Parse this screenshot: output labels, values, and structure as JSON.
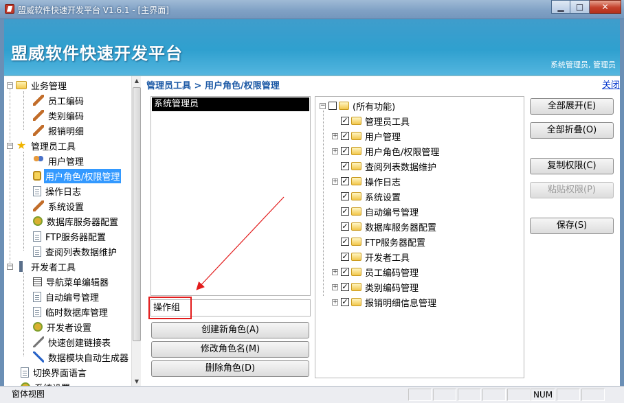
{
  "window": {
    "title": "盟威软件快速开发平台 V1.6.1 - [主界面]",
    "minimize_glyph": "▁",
    "maximize_glyph": "□",
    "close_glyph": "✕"
  },
  "banner": {
    "brand": "盟威软件快速开发平台",
    "user_info": "系统管理员, 管理员"
  },
  "nav": {
    "groups": [
      {
        "label": "业务管理",
        "expander": "−",
        "children": [
          "员工编码",
          "类别编码",
          "报销明细"
        ]
      },
      {
        "label": "管理员工具",
        "expander": "−",
        "children": [
          "用户管理",
          "用户角色/权限管理",
          "操作日志",
          "系统设置",
          "数据库服务器配置",
          "FTP服务器配置",
          "查阅列表数据维护"
        ]
      },
      {
        "label": "开发者工具",
        "expander": "−",
        "children": [
          "导航菜单编辑器",
          "自动编号管理",
          "临时数据库管理",
          "开发者设置",
          "快速创建链接表",
          "数据模块自动生成器"
        ]
      }
    ],
    "bottom_items": [
      "切换界面语言",
      "系统设置"
    ],
    "selected": "用户角色/权限管理",
    "scroll_up": "▲",
    "scroll_down": "▼"
  },
  "main": {
    "breadcrumb": "管理员工具 > 用户角色/权限管理",
    "close_link": "关闭",
    "roles": [
      "系统管理员"
    ],
    "role_name_input": "操作组",
    "role_buttons": {
      "create": "创建新角色(A)",
      "rename": "修改角色名(M)",
      "delete": "删除角色(D)"
    },
    "permission_tree": {
      "root": "(所有功能)",
      "items": [
        {
          "label": "管理员工具",
          "expander": ""
        },
        {
          "label": "用户管理",
          "expander": "+"
        },
        {
          "label": "用户角色/权限管理",
          "expander": "+"
        },
        {
          "label": "查阅列表数据维护",
          "expander": ""
        },
        {
          "label": "操作日志",
          "expander": "+"
        },
        {
          "label": "系统设置",
          "expander": ""
        },
        {
          "label": "自动编号管理",
          "expander": ""
        },
        {
          "label": "数据库服务器配置",
          "expander": ""
        },
        {
          "label": "FTP服务器配置",
          "expander": ""
        },
        {
          "label": "开发者工具",
          "expander": ""
        },
        {
          "label": "员工编码管理",
          "expander": "+"
        },
        {
          "label": "类别编码管理",
          "expander": "+"
        },
        {
          "label": "报销明细信息管理",
          "expander": "+"
        }
      ],
      "check_glyph": "✓"
    },
    "side_buttons": {
      "expand_all": "全部展开(E)",
      "collapse_all": "全部折叠(O)",
      "copy_perms": "复制权限(C)",
      "paste_perms": "粘贴权限(P)",
      "save": "保存(S)"
    }
  },
  "statusbar": {
    "view": "窗体视图",
    "num": "NUM"
  }
}
